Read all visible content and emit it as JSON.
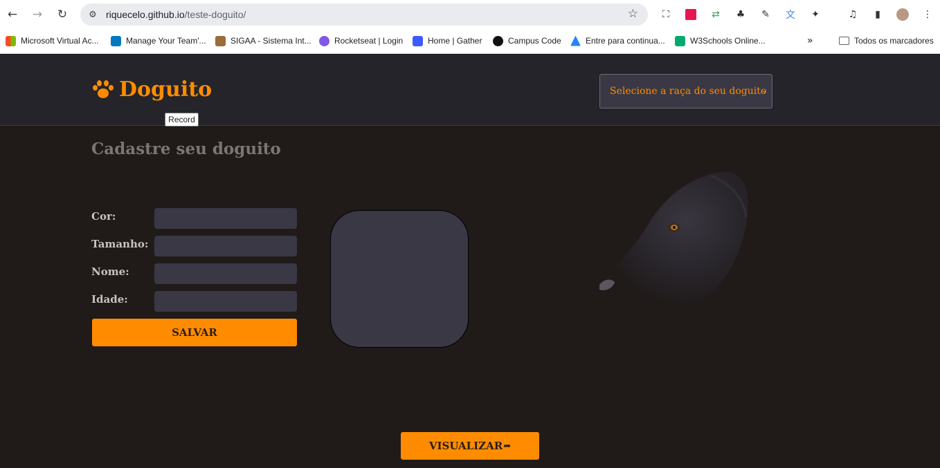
{
  "browser": {
    "url_host": "riquecelo.github.io",
    "url_path": "/teste-doguito/",
    "bookmarks": [
      {
        "label": "Microsoft Virtual Ac...",
        "icon": "microsoft-icon",
        "color": "#f25022"
      },
      {
        "label": "Manage Your Team'...",
        "icon": "trello-icon",
        "color": "#0079bf"
      },
      {
        "label": "SIGAA - Sistema Int...",
        "icon": "sigaa-icon",
        "color": "#9b6b3b"
      },
      {
        "label": "Rocketseat | Login",
        "icon": "rocketseat-icon",
        "color": "#8257e5"
      },
      {
        "label": "Home | Gather",
        "icon": "gather-icon",
        "color": "#3d5afe"
      },
      {
        "label": "Campus Code",
        "icon": "campus-code-icon",
        "color": "#111111"
      },
      {
        "label": "Entre para continua...",
        "icon": "atlassian-icon",
        "color": "#2684ff"
      },
      {
        "label": "W3Schools Online...",
        "icon": "w3schools-icon",
        "color": "#04aa6d"
      }
    ],
    "all_bookmarks_label": "Todos os marcadores"
  },
  "header": {
    "brand": "Doguito",
    "breed_select": "Selecione a raça do seu doguito",
    "tooltip": "Record"
  },
  "form": {
    "title": "Cadastre seu doguito",
    "fields": [
      {
        "label": "Cor:",
        "value": ""
      },
      {
        "label": "Tamanho:",
        "value": ""
      },
      {
        "label": "Nome:",
        "value": ""
      },
      {
        "label": "Idade:",
        "value": ""
      }
    ],
    "save_label": "SALVAR"
  },
  "view_label": "VISUALIZAR",
  "colors": {
    "accent": "#ff8c00",
    "background": "#201a19",
    "header": "#25242a",
    "input": "#3a3844"
  }
}
